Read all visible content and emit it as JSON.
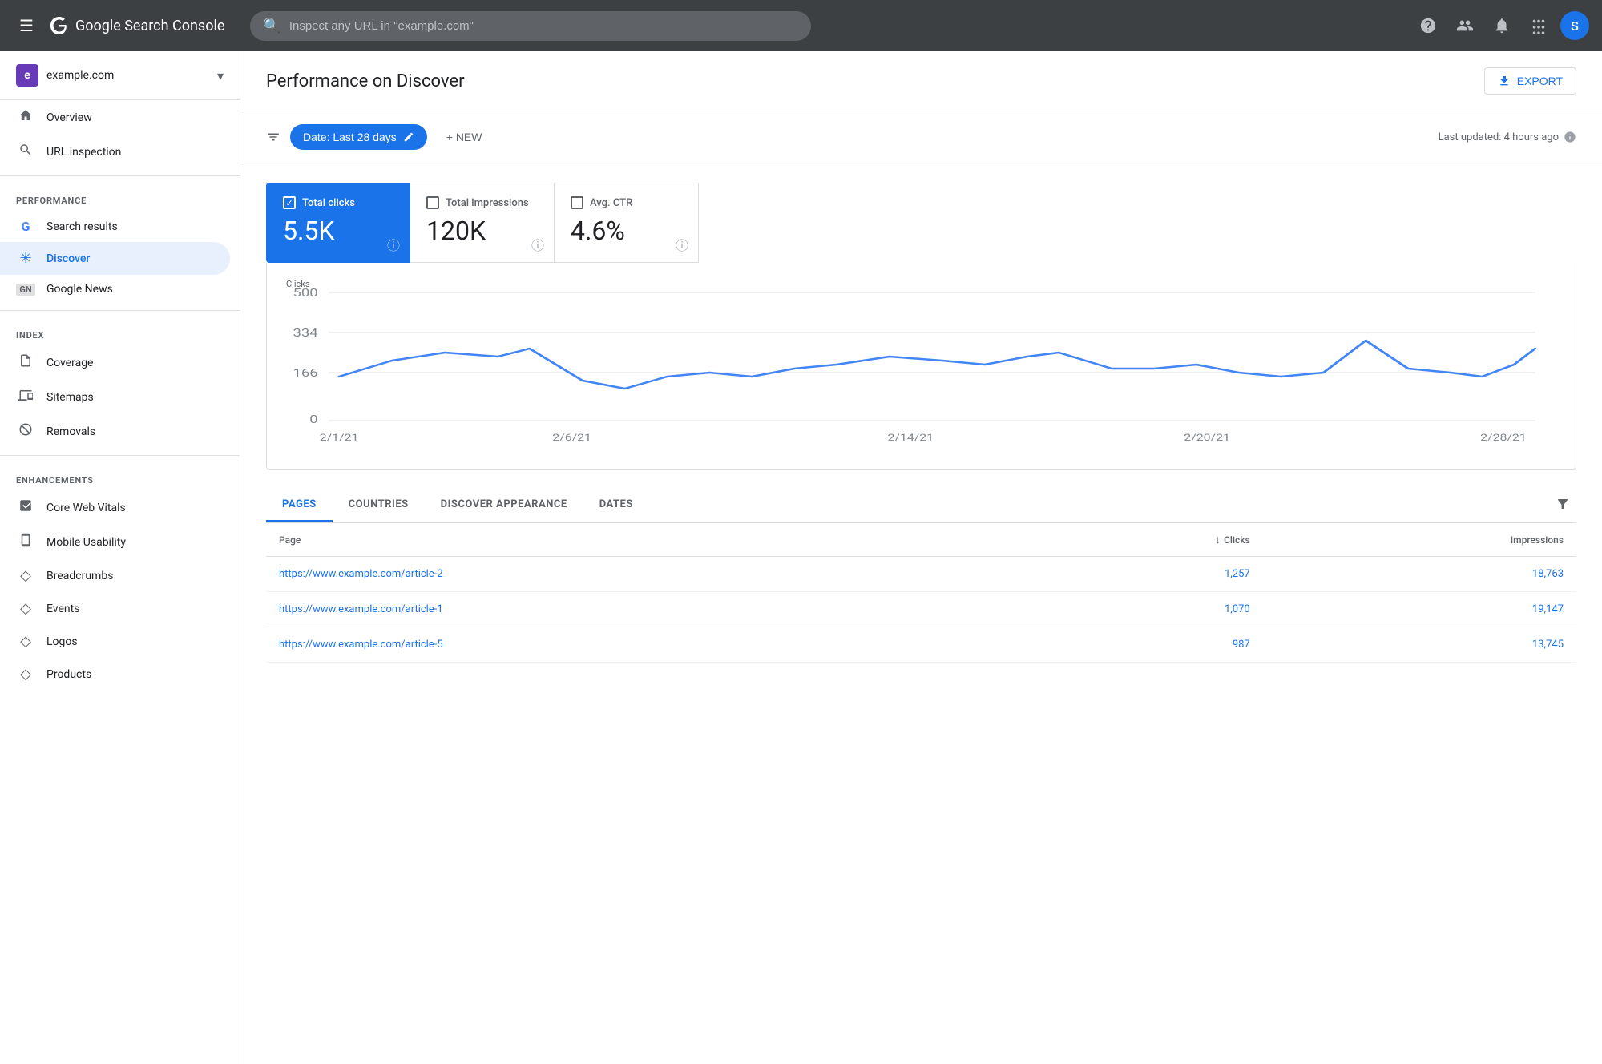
{
  "topbar": {
    "menu_icon": "☰",
    "logo_text": "Google Search Console",
    "search_placeholder": "Inspect any URL in \"example.com\"",
    "help_icon": "?",
    "people_icon": "👥",
    "bell_icon": "🔔",
    "grid_icon": "⊞",
    "avatar_letter": "S"
  },
  "sidebar": {
    "site_name": "example.com",
    "site_icon_letter": "e",
    "items": [
      {
        "id": "overview",
        "label": "Overview",
        "icon": "🏠",
        "section": null
      },
      {
        "id": "url-inspection",
        "label": "URL inspection",
        "icon": "🔍",
        "section": null
      },
      {
        "id": "performance-label",
        "label": "PERFORMANCE",
        "type": "section-label"
      },
      {
        "id": "search-results",
        "label": "Search results",
        "icon": "G",
        "type": "google"
      },
      {
        "id": "discover",
        "label": "Discover",
        "icon": "✳",
        "active": true
      },
      {
        "id": "google-news",
        "label": "Google News",
        "icon": "GN",
        "type": "google-news"
      },
      {
        "id": "index-label",
        "label": "INDEX",
        "type": "section-label"
      },
      {
        "id": "coverage",
        "label": "Coverage",
        "icon": "📄"
      },
      {
        "id": "sitemaps",
        "label": "Sitemaps",
        "icon": "🗂"
      },
      {
        "id": "removals",
        "label": "Removals",
        "icon": "🚫"
      },
      {
        "id": "enhancements-label",
        "label": "ENHANCEMENTS",
        "type": "section-label"
      },
      {
        "id": "core-web-vitals",
        "label": "Core Web Vitals",
        "icon": "📊"
      },
      {
        "id": "mobile-usability",
        "label": "Mobile Usability",
        "icon": "📱"
      },
      {
        "id": "breadcrumbs",
        "label": "Breadcrumbs",
        "icon": "◇"
      },
      {
        "id": "events",
        "label": "Events",
        "icon": "◇"
      },
      {
        "id": "logos",
        "label": "Logos",
        "icon": "◇"
      },
      {
        "id": "products",
        "label": "Products",
        "icon": "◇"
      }
    ]
  },
  "main": {
    "title": "Performance on Discover",
    "export_label": "EXPORT",
    "filter": {
      "date_label": "Date: Last 28 days",
      "new_label": "+ NEW",
      "last_updated": "Last updated: 4 hours ago"
    },
    "metrics": [
      {
        "id": "total-clicks",
        "label": "Total clicks",
        "value": "5.5K",
        "active": true
      },
      {
        "id": "total-impressions",
        "label": "Total impressions",
        "value": "120K",
        "active": false
      },
      {
        "id": "avg-ctr",
        "label": "Avg. CTR",
        "value": "4.6%",
        "active": false
      }
    ],
    "chart": {
      "y_label": "Clicks",
      "y_ticks": [
        "500",
        "334",
        "166",
        "0"
      ],
      "x_labels": [
        "2/1/21",
        "2/6/21",
        "2/14/21",
        "2/20/21",
        "2/28/21"
      ],
      "line_color": "#4285f4"
    },
    "tabs": [
      {
        "id": "pages",
        "label": "PAGES",
        "active": true
      },
      {
        "id": "countries",
        "label": "COUNTRIES",
        "active": false
      },
      {
        "id": "discover-appearance",
        "label": "DISCOVER APPEARANCE",
        "active": false
      },
      {
        "id": "dates",
        "label": "DATES",
        "active": false
      }
    ],
    "table": {
      "columns": [
        {
          "id": "page",
          "label": "Page",
          "align": "left"
        },
        {
          "id": "clicks",
          "label": "Clicks",
          "align": "right",
          "sort": true
        },
        {
          "id": "impressions",
          "label": "Impressions",
          "align": "right"
        }
      ],
      "rows": [
        {
          "page": "https://www.example.com/article-2",
          "clicks": "1,257",
          "impressions": "18,763"
        },
        {
          "page": "https://www.example.com/article-1",
          "clicks": "1,070",
          "impressions": "19,147"
        },
        {
          "page": "https://www.example.com/article-5",
          "clicks": "987",
          "impressions": "13,745"
        }
      ]
    }
  }
}
